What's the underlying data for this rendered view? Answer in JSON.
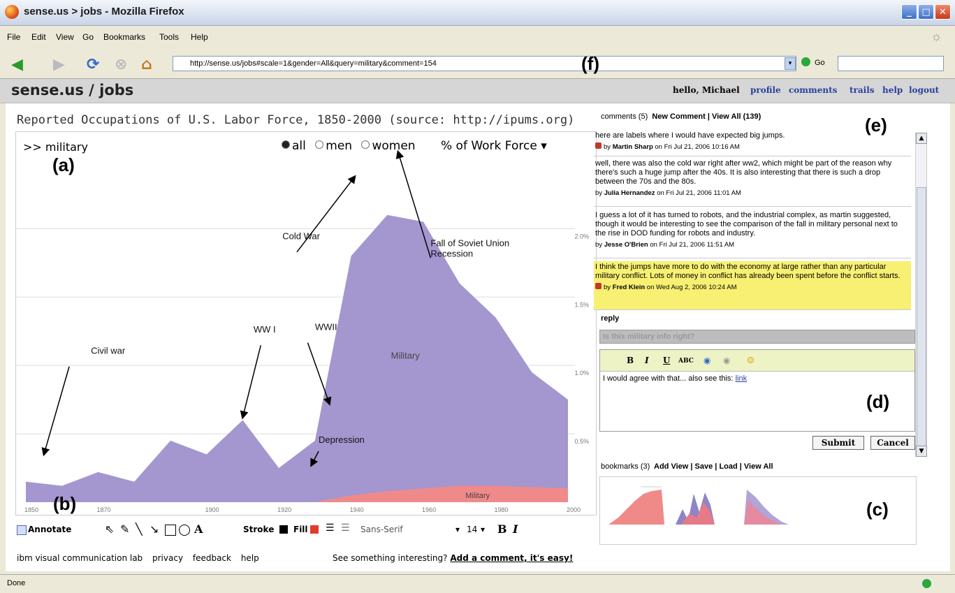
{
  "window": {
    "title": "sense.us > jobs - Mozilla Firefox"
  },
  "menu": [
    "File",
    "Edit",
    "View",
    "Go",
    "Bookmarks",
    "Tools",
    "Help"
  ],
  "toolbar": {
    "url": "http://sense.us/jobs#scale=1&gender=All&query=military&comment=154",
    "go_label": "Go"
  },
  "figure_labels": {
    "a": "(a)",
    "b": "(b)",
    "c": "(c)",
    "d": "(d)",
    "e": "(e)",
    "f": "(f)"
  },
  "app": {
    "brand": "sense.us / jobs",
    "greeting": "hello, Michael",
    "links": [
      "profile",
      "comments",
      "trails",
      "help",
      "logout"
    ]
  },
  "viz": {
    "title": "Reported Occupations of U.S. Labor Force, 1850-2000 (source: http://ipums.org)",
    "query": ">> military",
    "gender_options": [
      "all",
      "men",
      "women"
    ],
    "gender_selected": "all",
    "scale_label": "% of Work Force",
    "scale_arrow": "▾"
  },
  "chart_data": {
    "type": "area",
    "x": [
      1850,
      1860,
      1870,
      1880,
      1890,
      1900,
      1910,
      1920,
      1930,
      1940,
      1950,
      1960,
      1970,
      1980,
      1990,
      2000
    ],
    "x_ticks": [
      "1850",
      "1870",
      "1900",
      "1920",
      "1940",
      "1960",
      "1980",
      "2000"
    ],
    "y_ticks": [
      "0.5%",
      "1.0%",
      "1.5%",
      "2.0%"
    ],
    "ylim": [
      0,
      2.4
    ],
    "series": [
      {
        "name": "Military",
        "color": "#a497cf",
        "values": [
          0.15,
          0.12,
          0.22,
          0.15,
          0.45,
          0.35,
          0.6,
          0.25,
          0.45,
          1.8,
          2.1,
          2.05,
          1.6,
          1.35,
          0.95,
          0.75
        ]
      },
      {
        "name": "Military",
        "color": "#f08a8a",
        "values": [
          0.0,
          0.0,
          0.0,
          0.0,
          0.0,
          0.0,
          0.0,
          0.0,
          0.0,
          0.05,
          0.08,
          0.1,
          0.12,
          0.12,
          0.11,
          0.1
        ]
      }
    ],
    "annotations": [
      "Civil war",
      "WW I",
      "WWII",
      "Depression",
      "Cold War",
      "Fall of Soviet Union\nRecession"
    ]
  },
  "annotate_toolbar": {
    "annotate": "Annotate",
    "stroke": "Stroke",
    "fill": "Fill",
    "font": "Sans-Serif",
    "size": "14",
    "bold": "B",
    "italic": "I"
  },
  "footer": {
    "links": [
      "ibm visual communication lab",
      "privacy",
      "feedback",
      "help"
    ],
    "prompt": "See something interesting?",
    "cta": "Add a comment, it's easy!"
  },
  "comments": {
    "count_label": "comments (5)",
    "new": "New Comment",
    "view_all": "View All (139)",
    "items": [
      {
        "text": "here are labels where I would have expected big jumps.",
        "by": "Martin Sharp",
        "date": "on Fri Jul 21, 2006 10:16 AM",
        "highlight": false
      },
      {
        "text": "well, there was also the cold war right after ww2, which might be part of the reason why there's such a huge jump after the 40s. It is also interesting that there is such a drop between the 70s and the 80s.",
        "by": "Julia Hernandez",
        "date": "on Fri Jul 21, 2006 11:01 AM",
        "highlight": false
      },
      {
        "text": "I guess a lot of it has turned to robots, and the industrial complex, as martin suggested, though it would be interesting to see the comparison of the fall in military personal next to the rise in DOD funding for robots and industry.",
        "by": "Jesse O'Brien",
        "date": "on Fri Jul 21, 2006 11:51 AM",
        "highlight": false
      },
      {
        "text": "I think the jumps have more to do with the economy at large rather than any particular military conflict. Lots of money in conflict has already been spent before the conflict starts.",
        "by": "Fred Klein",
        "date": "on Wed Aug 2, 2006 10:24 AM",
        "highlight": true
      }
    ],
    "reply": "reply",
    "subject": "Is this military info right?",
    "editor_text": "I would agree with that... also see this:",
    "editor_link": "link",
    "submit": "Submit",
    "cancel": "Cancel"
  },
  "bookmarks": {
    "count_label": "bookmarks (3)",
    "add": "Add View",
    "save": "Save",
    "load": "Load",
    "view_all": "View All"
  },
  "status": {
    "text": "Done"
  }
}
